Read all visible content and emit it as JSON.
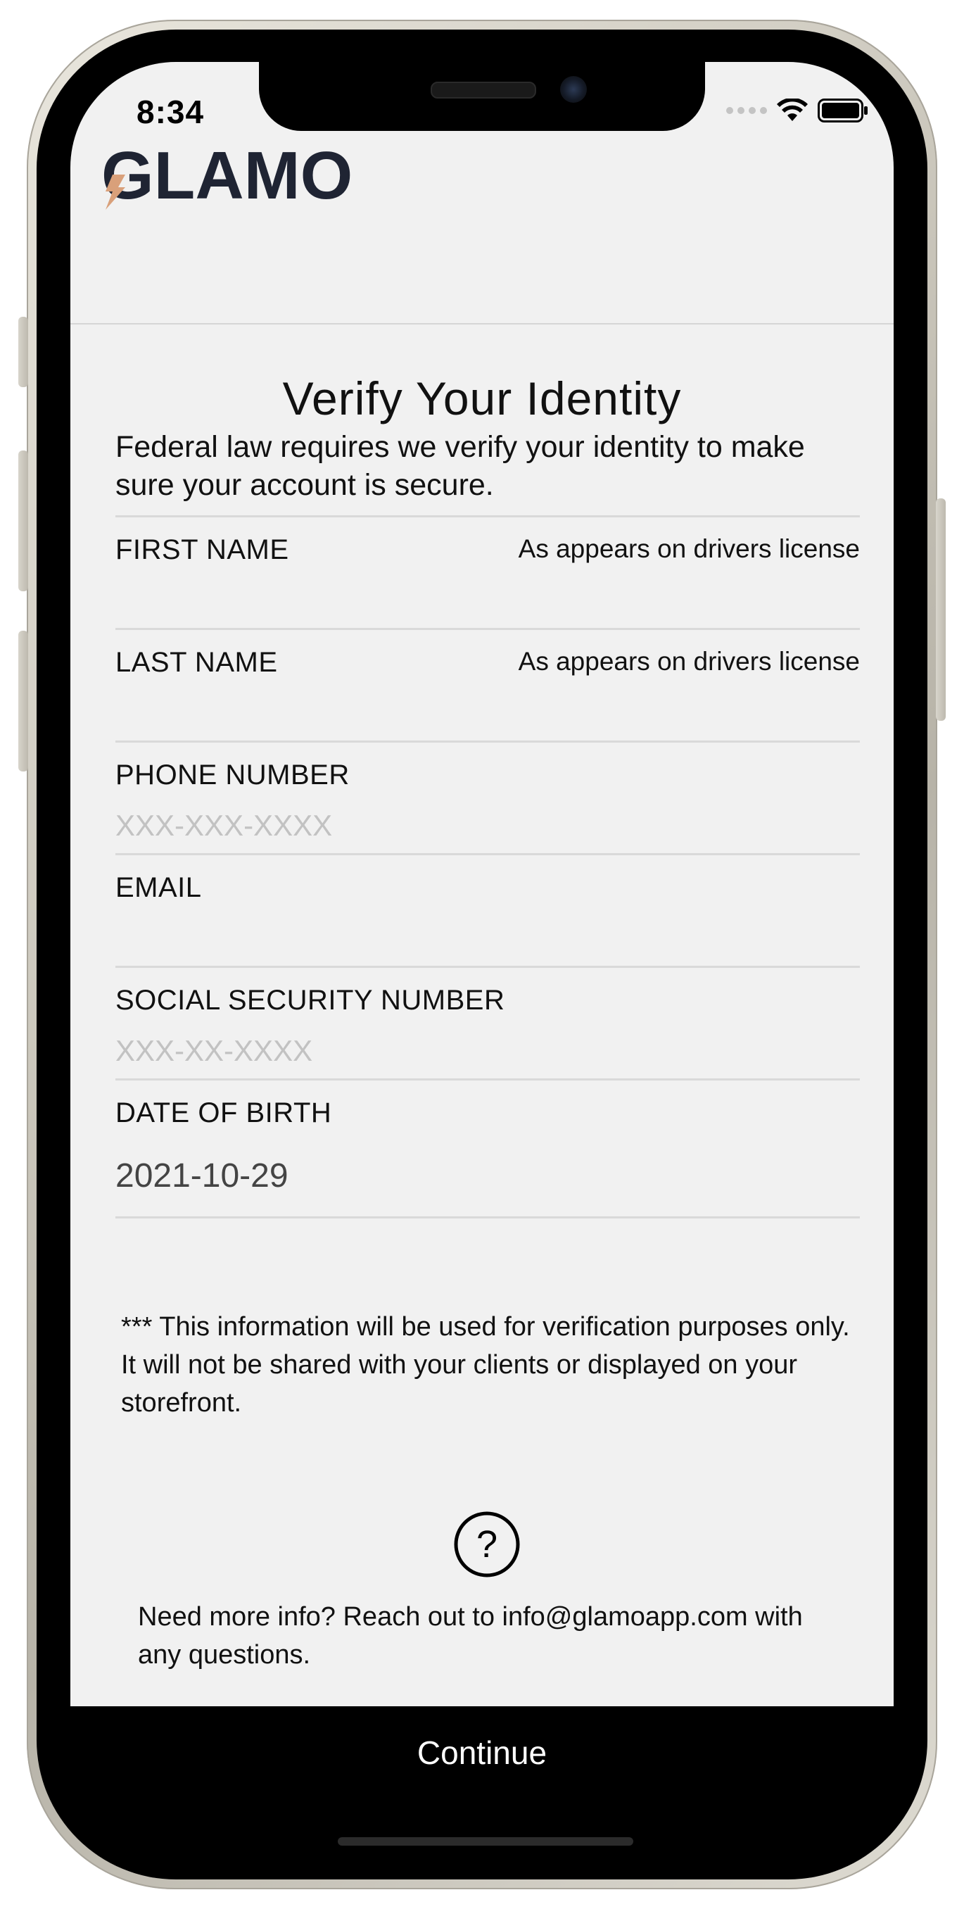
{
  "status_bar": {
    "time": "8:34"
  },
  "header": {
    "logo_text": "GLAMO"
  },
  "page": {
    "title": "Verify Your Identity",
    "subtitle": "Federal law requires we verify your identity to make sure your account is secure."
  },
  "form": {
    "first_name": {
      "label": "FIRST NAME",
      "hint": "As appears on drivers license",
      "value": "",
      "placeholder": ""
    },
    "last_name": {
      "label": "LAST NAME",
      "hint": "As appears on drivers license",
      "value": "",
      "placeholder": ""
    },
    "phone": {
      "label": "PHONE NUMBER",
      "value": "",
      "placeholder": "XXX-XXX-XXXX"
    },
    "email": {
      "label": "EMAIL",
      "value": "",
      "placeholder": ""
    },
    "ssn": {
      "label": "SOCIAL SECURITY NUMBER",
      "value": "",
      "placeholder": "XXX-XX-XXXX"
    },
    "dob": {
      "label": "DATE OF BIRTH",
      "value": "2021-10-29"
    }
  },
  "notice": "*** This information will be used for verification purposes only. It will not be shared with your clients or displayed on your storefront.",
  "help": {
    "icon": "question-circle-icon",
    "text": "Need more info? Reach out to info@glamoapp.com with any questions."
  },
  "footer": {
    "continue_label": "Continue"
  },
  "colors": {
    "background": "#f1f1f1",
    "logo_dark": "#1f2433",
    "logo_bolt": "#d9a07a",
    "button_bg": "#000000",
    "placeholder": "#c2c2c2"
  }
}
